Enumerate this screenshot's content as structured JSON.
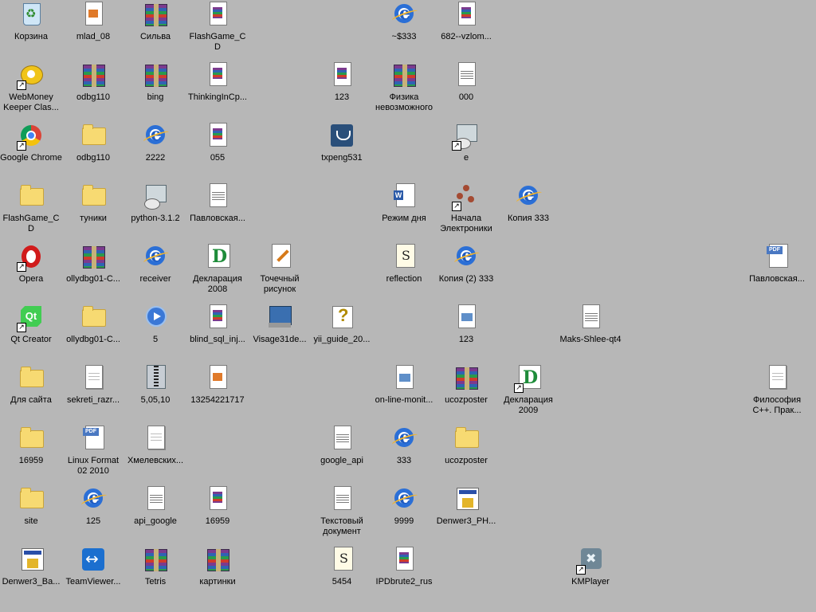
{
  "desktop": {
    "icons": [
      {
        "label": "Корзина",
        "icon": "recycle-bin",
        "shortcut": false
      },
      {
        "label": "mlad_08",
        "icon": "image-file",
        "shortcut": false
      },
      {
        "label": "Сильва",
        "icon": "winrar-archive",
        "shortcut": false
      },
      {
        "label": "FlashGame_CD",
        "icon": "winrar-document",
        "shortcut": false
      },
      {
        "label": "~$333",
        "icon": "ie-document",
        "shortcut": false
      },
      {
        "label": "682--vzlom...",
        "icon": "winrar-document",
        "shortcut": false
      },
      {
        "label": "WebMoney\nKeeper Clas...",
        "icon": "webmoney",
        "shortcut": true
      },
      {
        "label": "odbg110",
        "icon": "winrar-archive",
        "shortcut": false
      },
      {
        "label": "bing",
        "icon": "winrar-archive",
        "shortcut": false
      },
      {
        "label": "ThinkingInCp...",
        "icon": "winrar-document",
        "shortcut": false
      },
      {
        "label": "123",
        "icon": "winrar-document",
        "shortcut": false
      },
      {
        "label": "Физика\nневозможного",
        "icon": "winrar-archive",
        "shortcut": false
      },
      {
        "label": "000",
        "icon": "text-document",
        "shortcut": false
      },
      {
        "label": "Google Chrome",
        "icon": "chrome",
        "shortcut": true
      },
      {
        "label": "odbg110",
        "icon": "folder",
        "shortcut": false
      },
      {
        "label": "2222",
        "icon": "ie-document",
        "shortcut": false
      },
      {
        "label": "055",
        "icon": "winrar-document",
        "shortcut": false
      },
      {
        "label": "txpeng531",
        "icon": "installer-app",
        "shortcut": false
      },
      {
        "label": "e",
        "icon": "python-setup",
        "shortcut": true
      },
      {
        "label": "FlashGame_CD",
        "icon": "folder",
        "shortcut": false
      },
      {
        "label": "туники",
        "icon": "folder",
        "shortcut": false
      },
      {
        "label": "python-3.1.2",
        "icon": "python-setup",
        "shortcut": false
      },
      {
        "label": "Павловская...",
        "icon": "text-document",
        "shortcut": false
      },
      {
        "label": "Режим дня",
        "icon": "word-document",
        "shortcut": false
      },
      {
        "label": "Начала\nЭлектроники",
        "icon": "molecule-app",
        "shortcut": true
      },
      {
        "label": "Копия 333",
        "icon": "ie-document",
        "shortcut": false
      },
      {
        "label": "Opera",
        "icon": "opera",
        "shortcut": true
      },
      {
        "label": "ollydbg01-C...",
        "icon": "winrar-archive",
        "shortcut": false
      },
      {
        "label": "receiver",
        "icon": "ie-document",
        "shortcut": false
      },
      {
        "label": "Декларация\n2008",
        "icon": "declaration",
        "shortcut": false
      },
      {
        "label": "Точечный\nрисунок",
        "icon": "paint-bitmap",
        "shortcut": false
      },
      {
        "label": "reflection",
        "icon": "script-file",
        "shortcut": false
      },
      {
        "label": "Копия (2) 333",
        "icon": "ie-document",
        "shortcut": false
      },
      {
        "label": "Павловская...",
        "icon": "pdf-document",
        "shortcut": false
      },
      {
        "label": "Qt Creator",
        "icon": "qt-creator",
        "shortcut": true
      },
      {
        "label": "ollydbg01-C...",
        "icon": "folder",
        "shortcut": false
      },
      {
        "label": "5",
        "icon": "media-player",
        "shortcut": false
      },
      {
        "label": "blind_sql_inj...",
        "icon": "winrar-document",
        "shortcut": false
      },
      {
        "label": "Visage31de...",
        "icon": "setup-app",
        "shortcut": false
      },
      {
        "label": "yii_guide_20...",
        "icon": "help-file",
        "shortcut": false
      },
      {
        "label": "123",
        "icon": "data-file",
        "shortcut": false
      },
      {
        "label": "Maks-Shlee-qt4",
        "icon": "text-document",
        "shortcut": false
      },
      {
        "label": "Для сайта",
        "icon": "folder",
        "shortcut": false
      },
      {
        "label": "sekreti_razr...",
        "icon": "djvu-document",
        "shortcut": false
      },
      {
        "label": "5,05,10",
        "icon": "archive-file",
        "shortcut": false
      },
      {
        "label": "13254221717",
        "icon": "image-file",
        "shortcut": false
      },
      {
        "label": "on-line-monit...",
        "icon": "data-file",
        "shortcut": false
      },
      {
        "label": "ucozposter",
        "icon": "winrar-archive",
        "shortcut": false
      },
      {
        "label": "Декларация\n2009",
        "icon": "declaration",
        "shortcut": true
      },
      {
        "label": "Философия\nC++. Прак...",
        "icon": "djvu-document",
        "shortcut": false
      },
      {
        "label": "16959",
        "icon": "folder",
        "shortcut": false
      },
      {
        "label": "Linux Format\n02 2010",
        "icon": "pdf-document",
        "shortcut": false
      },
      {
        "label": "Хмелевских...",
        "icon": "djvu-document",
        "shortcut": false
      },
      {
        "label": "google_api",
        "icon": "text-document",
        "shortcut": false
      },
      {
        "label": "333",
        "icon": "ie-document",
        "shortcut": false
      },
      {
        "label": "ucozposter",
        "icon": "folder",
        "shortcut": false
      },
      {
        "label": "site",
        "icon": "folder",
        "shortcut": false
      },
      {
        "label": "125",
        "icon": "ie-document",
        "shortcut": false
      },
      {
        "label": "api_google",
        "icon": "text-document",
        "shortcut": false
      },
      {
        "label": "16959",
        "icon": "winrar-document",
        "shortcut": false
      },
      {
        "label": "Текстовый\nдокумент",
        "icon": "text-document",
        "shortcut": false
      },
      {
        "label": "9999",
        "icon": "ie-document",
        "shortcut": false
      },
      {
        "label": "Denwer3_PH...",
        "icon": "denwer-setup",
        "shortcut": false
      },
      {
        "label": "Denwer3_Ba...",
        "icon": "denwer-setup",
        "shortcut": false
      },
      {
        "label": "TeamViewer...",
        "icon": "teamviewer",
        "shortcut": false
      },
      {
        "label": "Tetris",
        "icon": "winrar-archive",
        "shortcut": false
      },
      {
        "label": "картинки",
        "icon": "winrar-archive",
        "shortcut": false
      },
      {
        "label": "5454",
        "icon": "script-file",
        "shortcut": false
      },
      {
        "label": "IPDbrute2_rus",
        "icon": "winrar-document",
        "shortcut": false
      },
      {
        "label": "KMPlayer",
        "icon": "kmplayer",
        "shortcut": true
      }
    ]
  }
}
